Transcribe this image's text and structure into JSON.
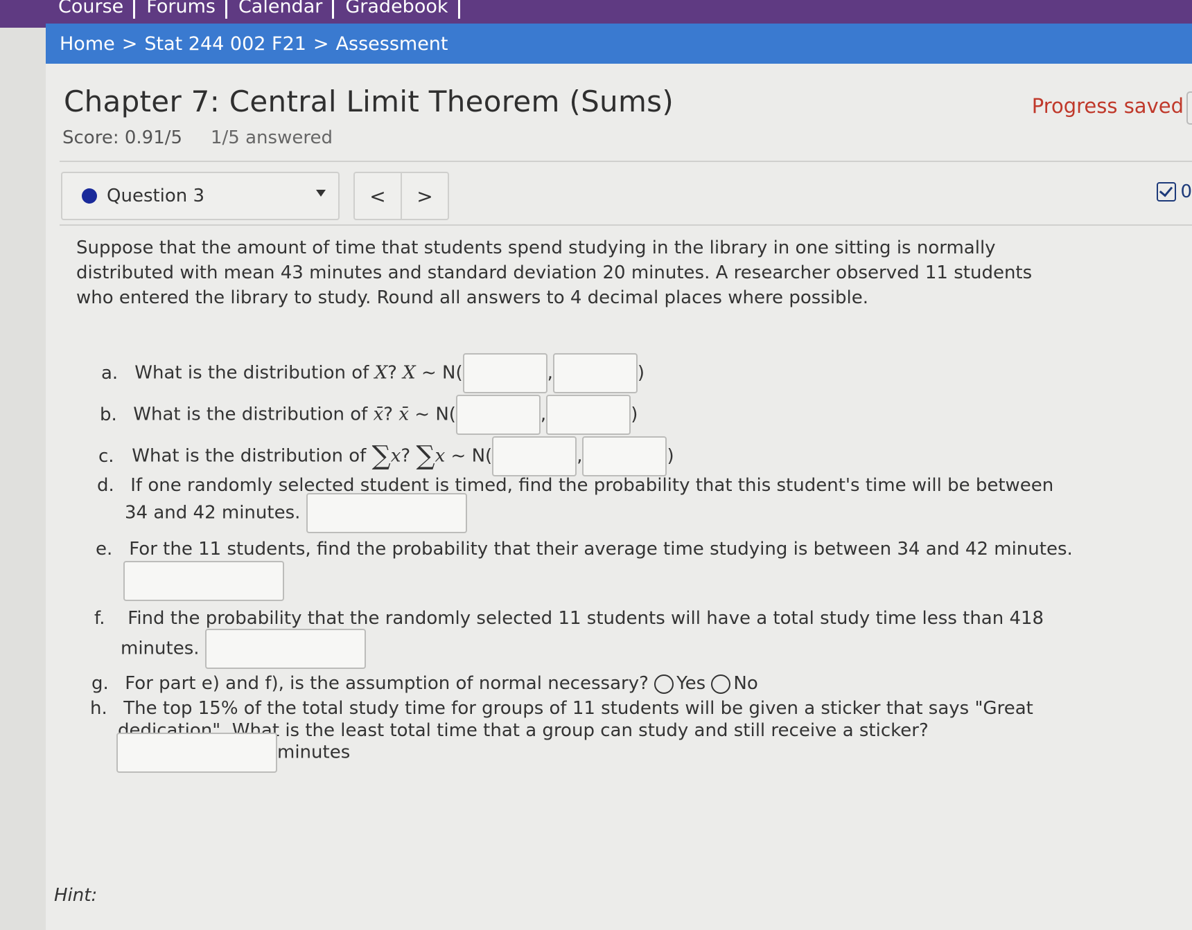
{
  "nav": {
    "items": [
      "Course",
      "Forums",
      "Calendar",
      "Gradebook"
    ]
  },
  "breadcrumb": {
    "home": "Home",
    "sep1": ">",
    "course": "Stat 244 002 F21",
    "sep2": ">",
    "page": "Assessment"
  },
  "header": {
    "title": "Chapter 7: Central Limit Theorem (Sums)",
    "score": "Score: 0.91/5",
    "answered": "1/5 answered",
    "progress": "Progress saved"
  },
  "question_nav": {
    "selected": "Question 3",
    "prev": "<",
    "next": ">",
    "attempt_count": "0"
  },
  "question": {
    "stem": "Suppose that the amount of time that students spend studying in the library in one sitting is normally distributed with mean 43 minutes and standard deviation 20 minutes. A researcher observed 11 students who entered the library to study. Round all answers to 4 decimal places where possible.",
    "a": {
      "label": "a.",
      "text": "What is the distribution of",
      "var": "X",
      "q": "?",
      "var2": "X",
      "dist": "~ N(",
      "comma": ",",
      "close": ")"
    },
    "b": {
      "label": "b.",
      "text": "What is the distribution of",
      "var": "x̄",
      "q": "?",
      "var2": "x̄",
      "dist": "~ N(",
      "comma": ",",
      "close": ")"
    },
    "c": {
      "label": "c.",
      "text": "What is the distribution of",
      "sigma": "∑",
      "var": "x",
      "q": "?",
      "var2": "x",
      "dist": "~ N(",
      "comma": ",",
      "close": ")"
    },
    "d": {
      "label": "d.",
      "line1": "If one randomly selected student is timed, find the probability that this student's time will be between",
      "line2": "34 and 42 minutes."
    },
    "e": {
      "label": "e.",
      "text": "For the 11 students, find the probability that their average time studying is between 34 and 42 minutes."
    },
    "f": {
      "label": "f.",
      "line1": "Find the probability that the randomly selected 11 students will have a total study time less than 418",
      "line2": "minutes."
    },
    "g": {
      "label": "g.",
      "text": "For part e) and f), is the assumption of normal necessary?",
      "opt_yes": "Yes",
      "opt_no": "No"
    },
    "h": {
      "label": "h.",
      "line1": "The top 15% of the total study time for groups of 11 students will be given a sticker that says \"Great",
      "line2": "dedication\". What is the least total time that a group can study and still receive a sticker?",
      "unit": "minutes"
    }
  },
  "hint": "Hint:"
}
